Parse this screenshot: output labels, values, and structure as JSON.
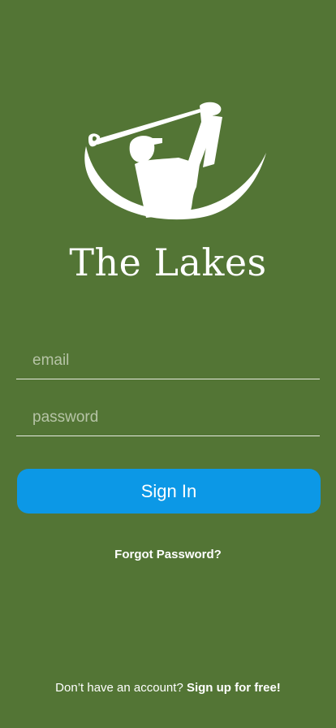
{
  "app": {
    "name": "The Lakes",
    "logo_icon": "golfer-swing-icon"
  },
  "form": {
    "email_placeholder": "email",
    "password_placeholder": "password",
    "sign_in_label": "Sign In",
    "forgot_label": "Forgot Password?"
  },
  "footer": {
    "prompt": "Don’t have an account?",
    "signup_label": "Sign up for free!"
  },
  "colors": {
    "background": "#537535",
    "primary_button": "#0c98e6",
    "text": "#ffffff"
  }
}
